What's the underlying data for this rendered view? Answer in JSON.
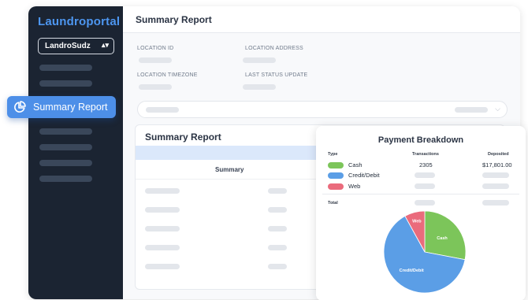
{
  "app": {
    "brand": "Laundroportal",
    "location_select": "LandroSudz"
  },
  "header": {
    "title": "Summary Report"
  },
  "details": {
    "location_id_label": "LOCATION ID",
    "location_address_label": "LOCATION ADDRESS",
    "location_timezone_label": "LOCATION TIMEZONE",
    "last_status_update_label": "LAST STATUS UPDATE"
  },
  "nav": {
    "active_label": "Summary Report",
    "active_icon": "pie-chart-icon"
  },
  "report": {
    "title": "Summary Report",
    "column_header": "Summary"
  },
  "payment_breakdown": {
    "title": "Payment Breakdown",
    "headers": {
      "type": "Type",
      "transactions": "Transactions",
      "deposited": "Deposited"
    },
    "rows": [
      {
        "type": "Cash",
        "color": "#7cc55a",
        "transactions": "2305",
        "deposited": "$17,801.00"
      },
      {
        "type": "Credit/Debit",
        "color": "#5b9ee6",
        "transactions": "",
        "deposited": ""
      },
      {
        "type": "Web",
        "color": "#ea6b7c",
        "transactions": "",
        "deposited": ""
      }
    ],
    "total_label": "Total"
  },
  "chart_data": {
    "type": "pie",
    "categories": [
      "Cash",
      "Credit/Debit",
      "Web"
    ],
    "values": [
      28,
      64,
      8
    ],
    "colors": [
      "#7cc55a",
      "#5b9ee6",
      "#ea6b7c"
    ],
    "labels": [
      "Cash",
      "Credit/Debit",
      "Web"
    ]
  }
}
